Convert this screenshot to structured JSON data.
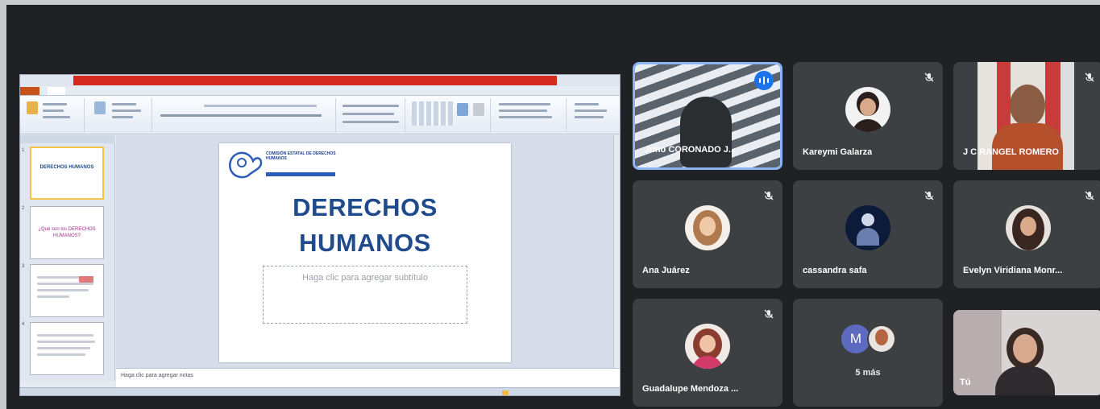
{
  "presentation": {
    "slide_title_line1": "DERECHOS",
    "slide_title_line2": "HUMANOS",
    "subtitle_placeholder": "Haga clic para agregar subtítulo",
    "notes_placeholder": "Haga clic para agregar notas",
    "logo_text": "COMISIÓN ESTATAL DE DERECHOS HUMANOS",
    "thumbnails": [
      {
        "num": "1",
        "text": "DERECHOS HUMANOS"
      },
      {
        "num": "2",
        "text": "¿Qué son los DERECHOS HUMANOS?"
      },
      {
        "num": "3",
        "text": ""
      },
      {
        "num": "4",
        "text": ""
      }
    ]
  },
  "participants": [
    {
      "name": "Juno CORONADO J...",
      "speaking": true
    },
    {
      "name": "Kareymi Galarza",
      "muted": true
    },
    {
      "name": "J C RANGEL ROMERO",
      "muted": true
    },
    {
      "name": "Ana Juárez",
      "muted": true
    },
    {
      "name": "cassandra safa",
      "muted": true
    },
    {
      "name": "Evelyn Viridiana Monr...",
      "muted": true
    },
    {
      "name": "Guadalupe Mendoza ...",
      "muted": true
    }
  ],
  "overflow_tile": {
    "initial": "M",
    "label": "5 más"
  },
  "self_tile": {
    "name": "Tú"
  },
  "colors": {
    "background": "#202124",
    "tile": "#3c4043",
    "active_border": "#8ab4f8",
    "speaking_badge": "#1a73e8",
    "slide_title": "#1f4a8c"
  },
  "icons": {
    "muted": "mic-off-icon",
    "speaking": "audio-wave-icon"
  }
}
